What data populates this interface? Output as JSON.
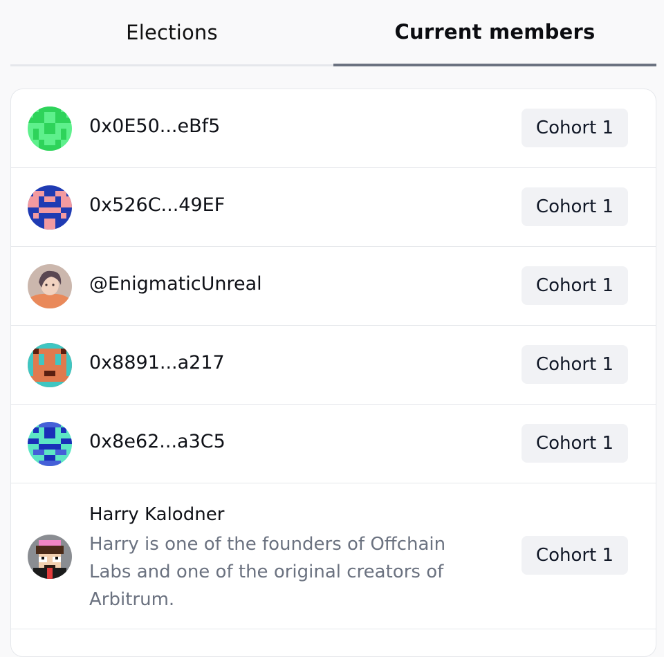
{
  "tabs": [
    {
      "label": "Elections",
      "active": false
    },
    {
      "label": "Current members",
      "active": true
    }
  ],
  "members": [
    {
      "name": "0x0E50...eBf5",
      "cohort": "Cohort 1",
      "avatar": "green-pixel-avatar"
    },
    {
      "name": "0x526C...49EF",
      "cohort": "Cohort 1",
      "avatar": "blue-pink-pixel-avatar"
    },
    {
      "name": "@EnigmaticUnreal",
      "cohort": "Cohort 1",
      "avatar": "portrait-avatar"
    },
    {
      "name": "0x8891...a217",
      "cohort": "Cohort 1",
      "avatar": "orange-teal-pixel-avatar"
    },
    {
      "name": "0x8e62...a3C5",
      "cohort": "Cohort 1",
      "avatar": "blue-mint-pixel-avatar"
    },
    {
      "name": "Harry Kalodner",
      "cohort": "Cohort 1",
      "avatar": "pixel-character-avatar",
      "description": "Harry is one of the founders of Offchain Labs and one of the original creators of Arbitrum."
    }
  ],
  "colors": {
    "page_bg": "#f9f9fa",
    "active_tab_underline": "#6b7280",
    "badge_bg": "#f1f2f5",
    "muted_text": "#6b7280"
  }
}
